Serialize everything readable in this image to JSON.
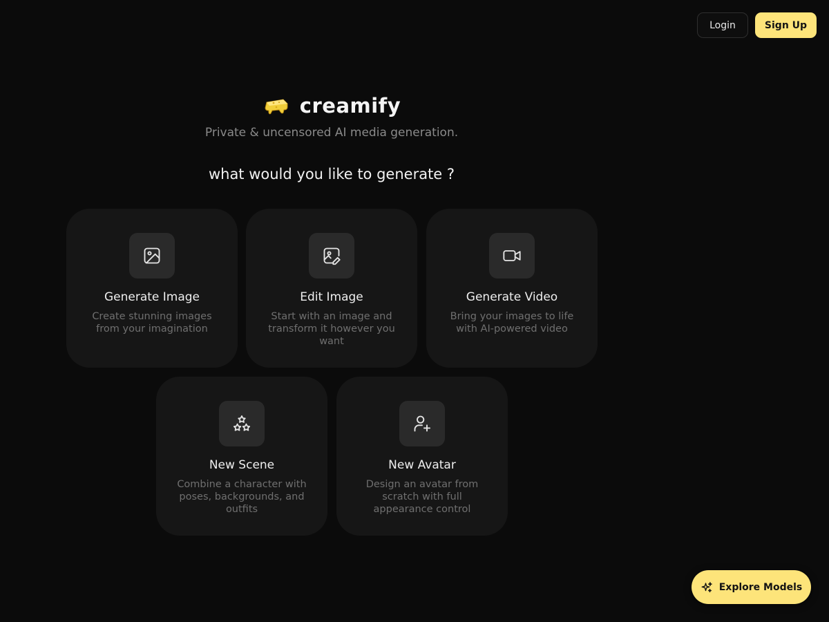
{
  "header": {
    "login_label": "Login",
    "signup_label": "Sign Up"
  },
  "brand": {
    "name": "creamify",
    "tagline": "Private & uncensored AI media generation.",
    "logo_icon": "cheese-melt-icon"
  },
  "prompt": "what would you like to generate ?",
  "cards": [
    {
      "icon": "image-icon",
      "title": "Generate Image",
      "description": "Create stunning images from your imagination"
    },
    {
      "icon": "image-edit-icon",
      "title": "Edit Image",
      "description": "Start with an image and transform it however you want"
    },
    {
      "icon": "video-camera-icon",
      "title": "Generate Video",
      "description": "Bring your images to life with AI-powered video"
    },
    {
      "icon": "stars-icon",
      "title": "New Scene",
      "description": "Combine a character with poses, backgrounds, and outfits"
    },
    {
      "icon": "user-plus-icon",
      "title": "New Avatar",
      "description": "Design an avatar from scratch with full appearance control"
    }
  ],
  "explore": {
    "label": "Explore Models",
    "icon": "sparkles-icon"
  },
  "colors": {
    "background": "#0b0b0b",
    "card": "#161616",
    "icon_box": "#2a2a2a",
    "accent": "#fde47a"
  }
}
